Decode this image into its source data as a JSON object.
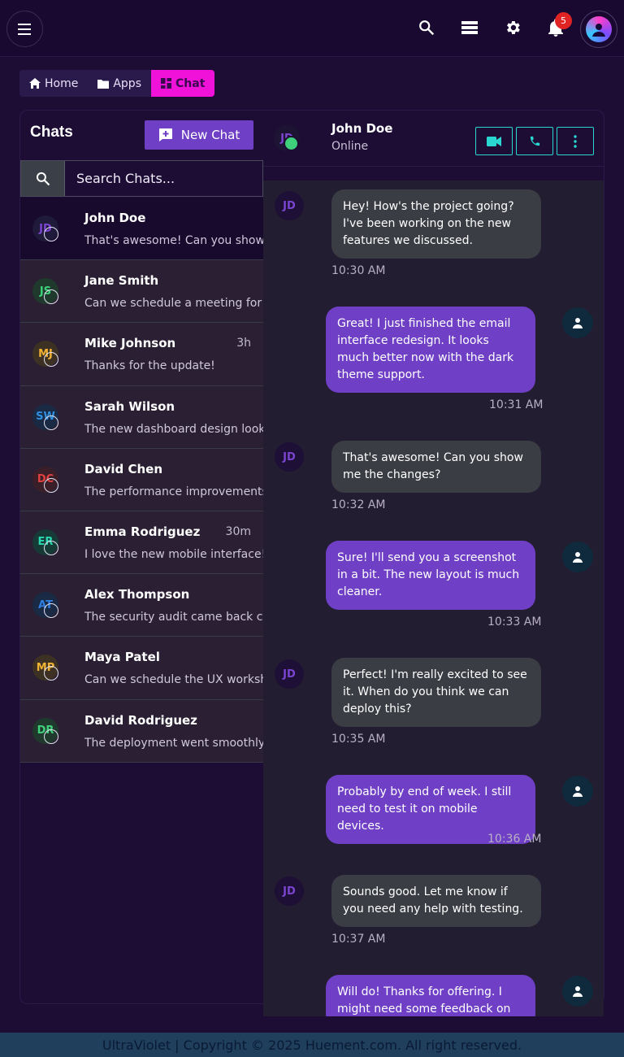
{
  "topbar": {
    "icons": [
      "menu-icon",
      "search-icon",
      "storage-icon",
      "gear-icon",
      "bell-icon",
      "avatar"
    ],
    "notifications_count": "5"
  },
  "breadcrumb": {
    "items": [
      {
        "label": "Home",
        "icon": "home-icon"
      },
      {
        "label": "Apps",
        "icon": "folder-icon"
      },
      {
        "label": "Chat",
        "icon": "dashboard-icon"
      }
    ]
  },
  "sidebar": {
    "title": "Chats",
    "new_chat_label": "New Chat",
    "search_placeholder": "Search Chats...",
    "chats": [
      {
        "initials": "JD",
        "name": "John Doe",
        "time": "",
        "message": "That's awesome! Can you show me the changes?",
        "color": "#7b45d0"
      },
      {
        "initials": "JS",
        "name": "Jane Smith",
        "time": "",
        "message": "Can we schedule a meeting for tomorrow?",
        "color": "#3ed07a"
      },
      {
        "initials": "MJ",
        "name": "Mike Johnson",
        "time": "3h",
        "message": "Thanks for the update!",
        "color": "#f0b232"
      },
      {
        "initials": "SW",
        "name": "Sarah Wilson",
        "time": "",
        "message": "The new dashboard design looks great!",
        "color": "#2f8fe0"
      },
      {
        "initials": "DC",
        "name": "David Chen",
        "time": "",
        "message": "The performance improvements are impressive",
        "color": "#e04040"
      },
      {
        "initials": "ER",
        "name": "Emma Rodriguez",
        "time": "30m",
        "message": "I love the new mobile interface!",
        "color": "#2ad7b0"
      },
      {
        "initials": "AT",
        "name": "Alex Thompson",
        "time": "",
        "message": "The security audit came back clean",
        "color": "#2f7fe0"
      },
      {
        "initials": "MP",
        "name": "Maya Patel",
        "time": "",
        "message": "Can we schedule the UX workshop?",
        "color": "#f0b232"
      },
      {
        "initials": "DR",
        "name": "David Rodriguez",
        "time": "",
        "message": "The deployment went smoothly, thanks!",
        "color": "#3ed07a"
      }
    ]
  },
  "conversation": {
    "contact_initials": "JD",
    "contact_name": "John Doe",
    "contact_status": "Online",
    "actions": [
      "video-call-icon",
      "phone-icon",
      "more-vert-icon"
    ],
    "messages": [
      {
        "from": "in",
        "text": "Hey! How's the project going? I've been working on the new features we discussed.",
        "time": "10:30 AM"
      },
      {
        "from": "out",
        "text": "Great! I just finished the email interface redesign. It looks much better now with the dark theme support.",
        "time": "10:31 AM"
      },
      {
        "from": "in",
        "text": "That's awesome! Can you show me the changes?",
        "time": "10:32 AM"
      },
      {
        "from": "out",
        "text": "Sure! I'll send you a screenshot in a bit. The new layout is much cleaner.",
        "time": "10:33 AM"
      },
      {
        "from": "in",
        "text": "Perfect! I'm really excited to see it. When do you think we can deploy this?",
        "time": "10:35 AM"
      },
      {
        "from": "out",
        "text": "Probably by end of week. I still need to test it on mobile devices.",
        "time": "10:36 AM"
      },
      {
        "from": "in",
        "text": "Sounds good. Let me know if you need any help with testing.",
        "time": "10:37 AM"
      },
      {
        "from": "out",
        "text": "Will do! Thanks for offering. I might need some feedback on",
        "time": ""
      }
    ]
  },
  "footer": {
    "text": "UltraViolet | Copyright © 2025 Huement.com. All right reserved."
  }
}
